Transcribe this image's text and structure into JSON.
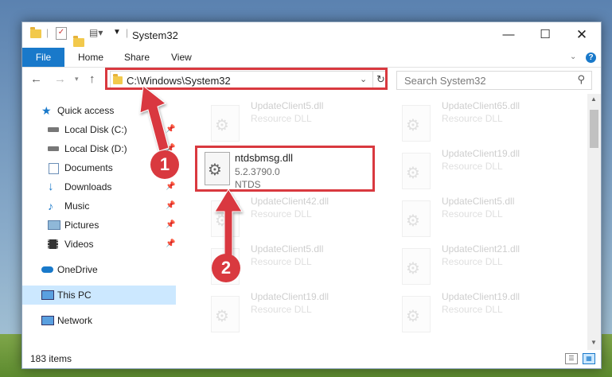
{
  "window": {
    "title": "System32"
  },
  "ribbon": {
    "tabs": [
      "File",
      "Home",
      "Share",
      "View"
    ]
  },
  "address": {
    "path": "C:\\Windows\\System32"
  },
  "search": {
    "placeholder": "Search System32"
  },
  "sidebar": {
    "items": [
      {
        "label": "Quick access",
        "icon": "star-icon"
      },
      {
        "label": "Local Disk (C:)",
        "icon": "drive-icon",
        "pinned": true
      },
      {
        "label": "Local Disk (D:)",
        "icon": "drive-icon",
        "pinned": true
      },
      {
        "label": "Documents",
        "icon": "documents-icon",
        "pinned": true
      },
      {
        "label": "Downloads",
        "icon": "download-icon",
        "pinned": true
      },
      {
        "label": "Music",
        "icon": "music-icon",
        "pinned": true
      },
      {
        "label": "Pictures",
        "icon": "pictures-icon",
        "pinned": true
      },
      {
        "label": "Videos",
        "icon": "videos-icon",
        "pinned": true
      },
      {
        "label": "OneDrive",
        "icon": "cloud-icon"
      },
      {
        "label": "This PC",
        "icon": "computer-icon",
        "selected": true
      },
      {
        "label": "Network",
        "icon": "network-icon"
      }
    ]
  },
  "files": {
    "focused": {
      "name": "ntdsbmsg.dll",
      "version": "5.2.3790.0",
      "company": "NTDS"
    },
    "tiles": [
      {
        "name": "UpdateClient5.dll",
        "desc": "Resource DLL"
      },
      {
        "name": "UpdateClient65.dll",
        "desc": "Resource DLL"
      },
      {
        "name": "UpdateClient19.dll",
        "desc": "Resource DLL"
      },
      {
        "name": "UpdateClient42.dll",
        "desc": "Resource DLL"
      },
      {
        "name": "UpdateClient5.dll",
        "desc": "Resource DLL"
      },
      {
        "name": "UpdateClient5.dll",
        "desc": "Resource DLL"
      },
      {
        "name": "UpdateClient21.dll",
        "desc": "Resource DLL"
      },
      {
        "name": "UpdateClient19.dll",
        "desc": "Resource DLL"
      },
      {
        "name": "UpdateClient19.dll",
        "desc": "Resource DLL"
      }
    ]
  },
  "status": {
    "count": "183 items"
  },
  "annotations": {
    "step1": "1",
    "step2": "2",
    "color": "#d9393f"
  }
}
